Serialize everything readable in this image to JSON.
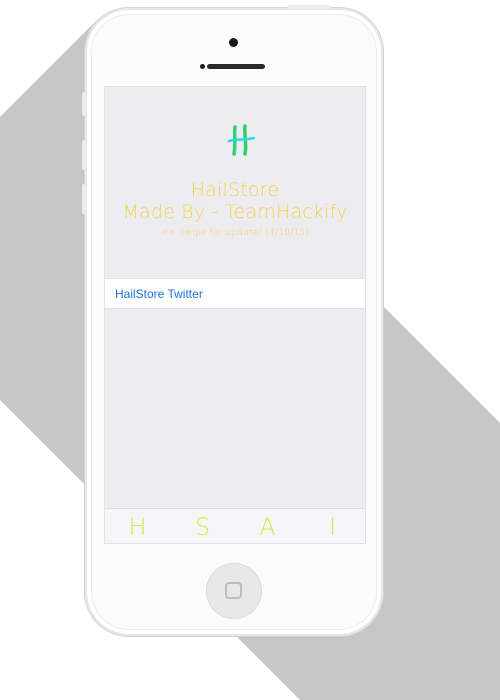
{
  "app": {
    "logo_text": "H",
    "title": "HailStore",
    "subtitle": "Made By - TeamHackify",
    "notice": "<< swipe for update! (4/10/15)"
  },
  "list": {
    "items": [
      {
        "label": "HailStore Twitter"
      }
    ]
  },
  "tabbar": {
    "tabs": [
      {
        "label": "H"
      },
      {
        "label": "S"
      },
      {
        "label": "A"
      },
      {
        "label": "I"
      }
    ]
  },
  "colors": {
    "title": "#f3d34a",
    "link": "#1a73d9",
    "tab": "#c6ef4a",
    "logo_green": "#2fd06b",
    "logo_cyan": "#33d8d8"
  }
}
